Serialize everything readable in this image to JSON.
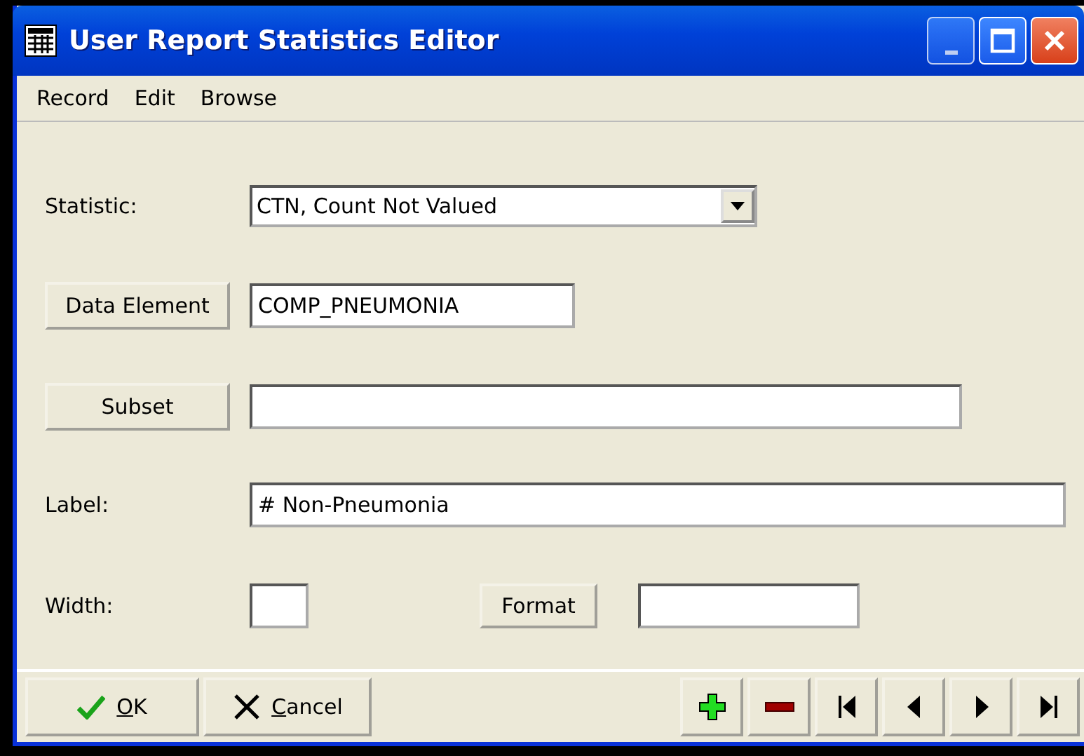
{
  "window": {
    "title": "User Report Statistics Editor"
  },
  "menu": [
    "Record",
    "Edit",
    "Browse"
  ],
  "form": {
    "statistic": {
      "label": "Statistic:",
      "value": "CTN, Count Not Valued"
    },
    "data_element": {
      "button": "Data Element",
      "value": "COMP_PNEUMONIA"
    },
    "subset": {
      "button": "Subset"
    },
    "label": {
      "label": "Label:",
      "value": "# Non-Pneumonia"
    },
    "width": {
      "label": "Width:"
    },
    "format": {
      "button": "Format"
    }
  },
  "buttons": [
    {
      "kind": "ok",
      "label": "OK"
    },
    {
      "kind": "cancel",
      "label": "Cancel"
    }
  ],
  "nav_buttons": [
    {
      "kind": "add"
    },
    {
      "kind": "delete"
    },
    {
      "kind": "first"
    },
    {
      "kind": "prev"
    },
    {
      "kind": "next"
    },
    {
      "kind": "last"
    }
  ]
}
